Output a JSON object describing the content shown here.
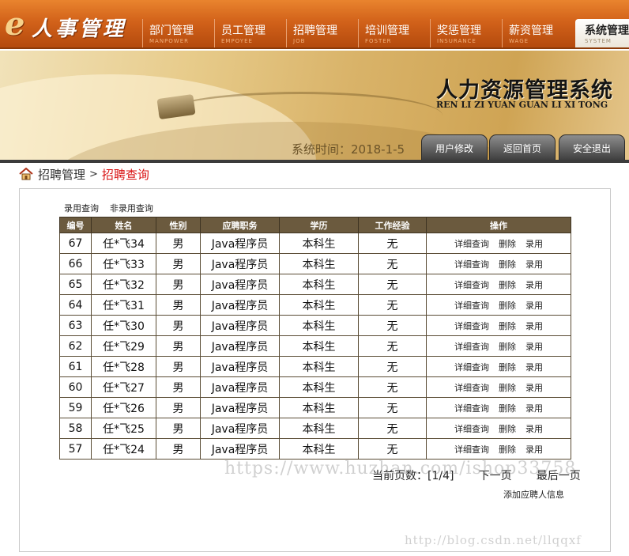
{
  "logo": {
    "e": "e",
    "text": "人事管理"
  },
  "nav": [
    {
      "zh": "部门管理",
      "en": "MANPOWER"
    },
    {
      "zh": "员工管理",
      "en": "EMPOYEE"
    },
    {
      "zh": "招聘管理",
      "en": "JOB"
    },
    {
      "zh": "培训管理",
      "en": "FOSTER"
    },
    {
      "zh": "奖惩管理",
      "en": "INSURANCE"
    },
    {
      "zh": "薪资管理",
      "en": "WAGE"
    },
    {
      "zh": "系统管理",
      "en": "SYSTEM",
      "active": true
    }
  ],
  "banner": {
    "title": "人力资源管理系统",
    "pinyin": "REN LI ZI YUAN GUAN LI XI TONG",
    "time": "系统时间：2018-1-5",
    "buttons": [
      "用户修改",
      "返回首页",
      "安全退出"
    ]
  },
  "breadcrumb": {
    "parent": "招聘管理",
    "sep": ">",
    "current": "招聘查询"
  },
  "filters": [
    "录用查询",
    "非录用查询"
  ],
  "table": {
    "headers": [
      "编号",
      "姓名",
      "性别",
      "应聘职务",
      "学历",
      "工作经验",
      "操作"
    ],
    "actions": [
      "详细查询",
      "删除",
      "录用"
    ],
    "rows": [
      [
        "67",
        "任*飞34",
        "男",
        "Java程序员",
        "本科生",
        "无"
      ],
      [
        "66",
        "任*飞33",
        "男",
        "Java程序员",
        "本科生",
        "无"
      ],
      [
        "65",
        "任*飞32",
        "男",
        "Java程序员",
        "本科生",
        "无"
      ],
      [
        "64",
        "任*飞31",
        "男",
        "Java程序员",
        "本科生",
        "无"
      ],
      [
        "63",
        "任*飞30",
        "男",
        "Java程序员",
        "本科生",
        "无"
      ],
      [
        "62",
        "任*飞29",
        "男",
        "Java程序员",
        "本科生",
        "无"
      ],
      [
        "61",
        "任*飞28",
        "男",
        "Java程序员",
        "本科生",
        "无"
      ],
      [
        "60",
        "任*飞27",
        "男",
        "Java程序员",
        "本科生",
        "无"
      ],
      [
        "59",
        "任*飞26",
        "男",
        "Java程序员",
        "本科生",
        "无"
      ],
      [
        "58",
        "任*飞25",
        "男",
        "Java程序员",
        "本科生",
        "无"
      ],
      [
        "57",
        "任*飞24",
        "男",
        "Java程序员",
        "本科生",
        "无"
      ]
    ]
  },
  "pager": {
    "label": "当前页数：[1/4]",
    "next": "下一页",
    "last": "最后一页"
  },
  "add_link": "添加应聘人信息",
  "watermarks": [
    "https://www.huzhan.com/ishop33758",
    "http://blog.csdn.net/llqqxf"
  ]
}
